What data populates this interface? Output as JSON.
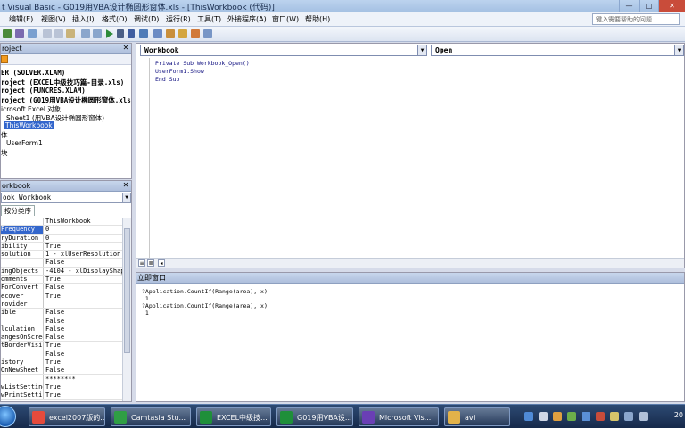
{
  "window": {
    "title": "t Visual Basic - G019用VBA设计椭圆形窗体.xls - [ThisWorkbook (代码)]",
    "controls": [
      "—",
      "□",
      "✕"
    ]
  },
  "menu": {
    "items": [
      "编辑(E)",
      "视图(V)",
      "插入(I)",
      "格式(O)",
      "调试(D)",
      "运行(R)",
      "工具(T)",
      "外接程序(A)",
      "窗口(W)",
      "帮助(H)"
    ],
    "help_placeholder": "键入需要帮助的问题"
  },
  "toolbar": {
    "position_text": ""
  },
  "project": {
    "title": "roject",
    "items": [
      {
        "text": "ER (SOLVER.XLAM)",
        "bold": true
      },
      {
        "text": "roject (EXCEL中级技巧篇-目录.xls)",
        "bold": true
      },
      {
        "text": "roject (FUNCRES.XLAM)",
        "bold": true
      },
      {
        "text": "roject (G019用VBA设计椭圆形窗体.xls",
        "bold": true
      },
      {
        "text": "icrosoft Excel 对象",
        "bold": false
      },
      {
        "text": "Sheet1 (用VBA设计椭圆形窗体)",
        "bold": false
      },
      {
        "text": "ThisWorkbook",
        "bold": false,
        "selected": true
      },
      {
        "text": "体",
        "bold": false
      },
      {
        "text": "UserForm1",
        "bold": false
      },
      {
        "text": "块",
        "bold": false
      }
    ]
  },
  "properties": {
    "title": "orkbook",
    "object_combo": "ook Workbook",
    "tab_label": "按分类序",
    "rows": [
      {
        "name": "",
        "value": "ThisWorkbook"
      },
      {
        "name": "Frequency",
        "value": "0",
        "selected": true
      },
      {
        "name": "ryDuration",
        "value": "0"
      },
      {
        "name": "ibility",
        "value": "True"
      },
      {
        "name": "solution",
        "value": "1 - xlUserResolution"
      },
      {
        "name": "",
        "value": "False"
      },
      {
        "name": "ingObjects",
        "value": "-4104 - xlDisplayShape"
      },
      {
        "name": "omments",
        "value": "True"
      },
      {
        "name": "ForConvert",
        "value": "False"
      },
      {
        "name": "ecover",
        "value": "True"
      },
      {
        "name": "rovider",
        "value": ""
      },
      {
        "name": "ible",
        "value": "False"
      },
      {
        "name": "",
        "value": "False"
      },
      {
        "name": "lculation",
        "value": "False"
      },
      {
        "name": "angesOnScreen",
        "value": "False"
      },
      {
        "name": "tBorderVisib",
        "value": "True"
      },
      {
        "name": "",
        "value": "False"
      },
      {
        "name": "istory",
        "value": "True"
      },
      {
        "name": "OnNewSheet",
        "value": "False"
      },
      {
        "name": "",
        "value": "********"
      },
      {
        "name": "wListSetting",
        "value": "True"
      },
      {
        "name": "wPrintSettin",
        "value": "True"
      }
    ]
  },
  "code": {
    "object_combo": "Workbook",
    "proc_combo": "Open",
    "lines": [
      "Private Sub Workbook_Open()",
      "UserForm1.Show",
      "End Sub"
    ]
  },
  "immediate": {
    "title": "立即窗口",
    "lines": [
      "?Application.CountIf(Range(area), x)",
      " 1",
      "?Application.CountIf(Range(area), x)",
      " 1"
    ]
  },
  "taskbar": {
    "tasks": [
      {
        "label": "excel2007版的...",
        "color": "#e54b3c"
      },
      {
        "label": "Camtasia Stu...",
        "color": "#2f9e44"
      },
      {
        "label": "EXCEL中级技...",
        "color": "#1f8f3a"
      },
      {
        "label": "G019用VBA设...",
        "color": "#1f8f3a"
      },
      {
        "label": "Microsoft Vis...",
        "color": "#6a3fb5"
      },
      {
        "label": "avi",
        "color": "#e2b24a"
      }
    ],
    "clock": "20"
  }
}
